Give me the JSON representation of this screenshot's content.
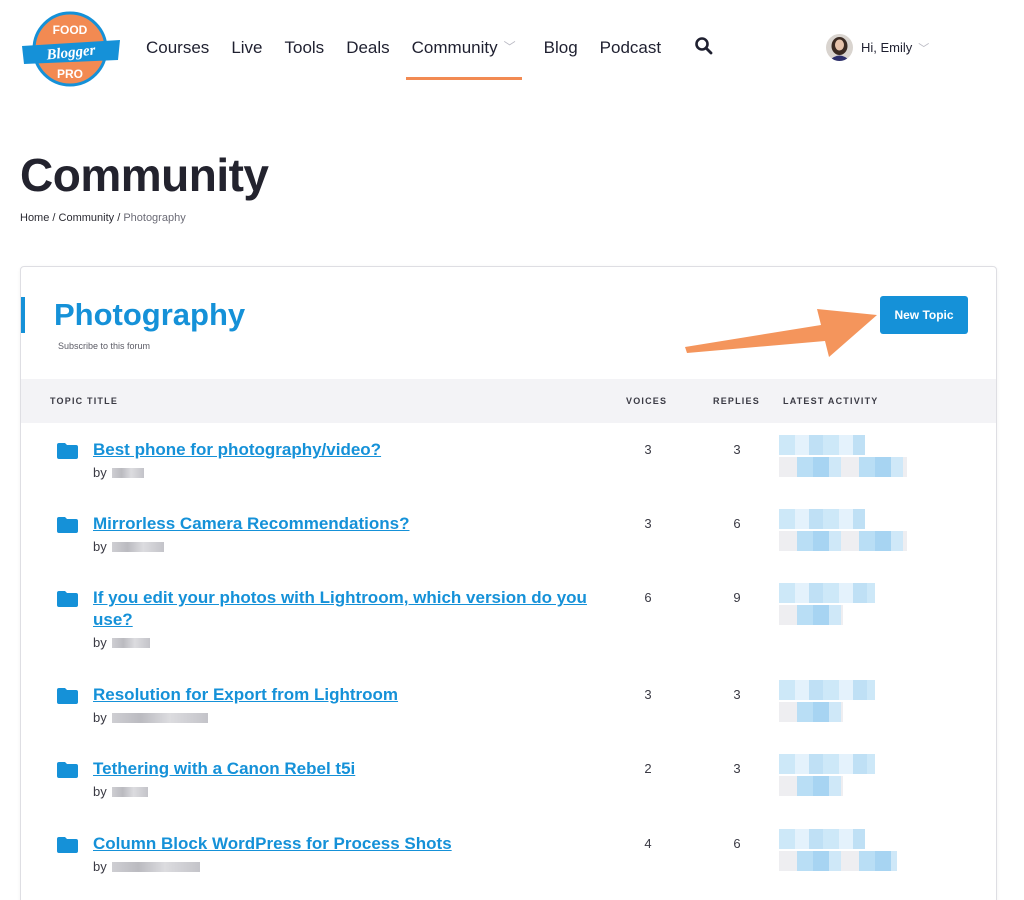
{
  "header": {
    "logo_text": [
      "FOOD",
      "Blogger",
      "PRO"
    ],
    "nav": [
      {
        "label": "Courses"
      },
      {
        "label": "Live"
      },
      {
        "label": "Tools"
      },
      {
        "label": "Deals"
      },
      {
        "label": "Community",
        "active": true,
        "has_dropdown": true
      },
      {
        "label": "Blog"
      },
      {
        "label": "Podcast"
      }
    ],
    "search_icon": "search-icon",
    "user": {
      "greeting": "Hi, Emily"
    }
  },
  "page": {
    "title": "Community",
    "breadcrumb": {
      "home": "Home",
      "sep1": " / ",
      "community": "Community",
      "sep2": " / ",
      "current": "Photography"
    }
  },
  "forum": {
    "title": "Photography",
    "subscribe": "Subscribe to this forum",
    "new_topic_label": "New Topic",
    "columns": {
      "topic": "TOPIC TITLE",
      "voices": "VOICES",
      "replies": "REPLIES",
      "activity": "LATEST ACTIVITY"
    },
    "topics": [
      {
        "title": "Best phone for photography/video?",
        "by": "by",
        "voices": "3",
        "replies": "3"
      },
      {
        "title": "Mirrorless Camera Recommendations?",
        "by": "by",
        "voices": "3",
        "replies": "6"
      },
      {
        "title": "If you edit your photos with Lightroom, which version do you use?",
        "by": "by",
        "voices": "6",
        "replies": "9"
      },
      {
        "title": "Resolution for Export from Lightroom",
        "by": "by",
        "voices": "3",
        "replies": "3"
      },
      {
        "title": "Tethering with a Canon Rebel t5i",
        "by": "by",
        "voices": "2",
        "replies": "3"
      },
      {
        "title": "Column Block WordPress for Process Shots",
        "by": "by",
        "voices": "4",
        "replies": "6"
      }
    ]
  },
  "colors": {
    "accent": "#1591d8",
    "nav_underline": "#f28a52",
    "arrow": "#f4955c",
    "logo_orange": "#f28a52",
    "logo_blue": "#1591d8"
  }
}
